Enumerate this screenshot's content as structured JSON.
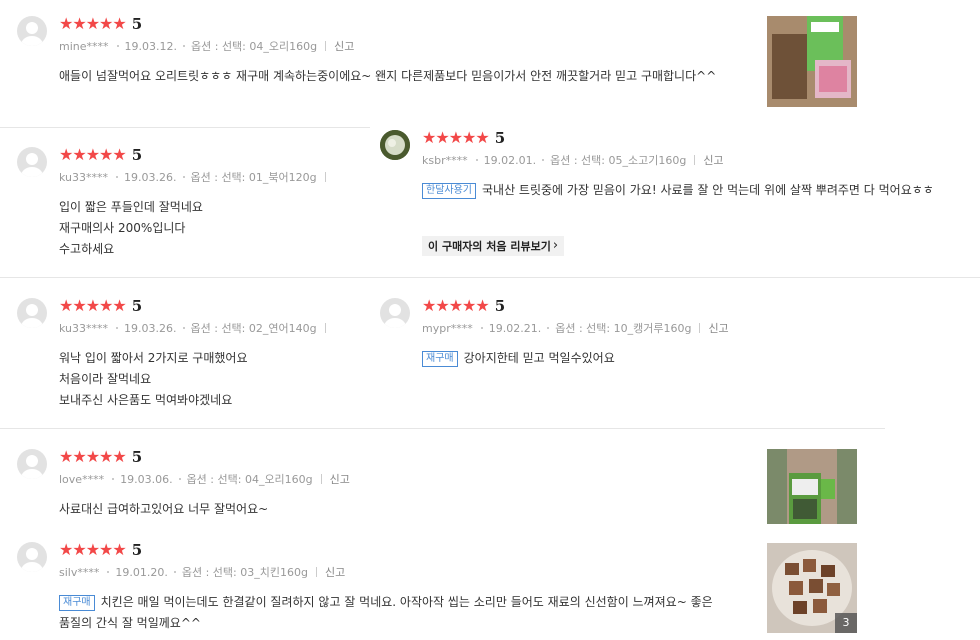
{
  "star_glyph": "★★★★★",
  "colors": {
    "star": "#f24848",
    "badge": "#4a8bd5"
  },
  "reviews": [
    {
      "score": "5",
      "user": "mine****",
      "date": "19.03.12.",
      "option": "옵션 : 선택: 04_오리160g",
      "report": "신고",
      "lines": [
        "애들이 넘잘먹어요 오리트릿ㅎㅎㅎ 재구매 계속하는중이에요~ 왠지 다른제품보다 믿음이가서 안전 깨끗할거라 믿고 구매합니다^^"
      ]
    },
    {
      "score": "5",
      "user": "ku33****",
      "date": "19.03.26.",
      "option": "옵션 : 선택: 01_북어120g",
      "lines": [
        "입이 짧은 푸들인데 잘먹네요",
        "재구매의사 200%입니다",
        "수고하세요"
      ]
    },
    {
      "score": "5",
      "user": "ksbr****",
      "date": "19.02.01.",
      "option": "옵션 : 선택: 05_소고기160g",
      "report": "신고",
      "badge": "한달사용기",
      "lines": [
        "국내산 트릿중에 가장 믿음이 가요! 사료를 잘 안 먹는데 위에 살짝 뿌려주면 다 먹어요ㅎㅎ"
      ],
      "first_review_label": "이 구매자의 처음 리뷰보기"
    },
    {
      "score": "5",
      "user": "ku33****",
      "date": "19.03.26.",
      "option": "옵션 : 선택: 02_연어140g",
      "lines": [
        "워낙 입이 짧아서 2가지로 구매했어요",
        "처음이라 잘먹네요",
        "보내주신 사은품도 먹여봐야겠네요"
      ]
    },
    {
      "score": "5",
      "user": "mypr****",
      "date": "19.02.21.",
      "option": "옵션 : 선택: 10_캥거루160g",
      "report": "신고",
      "badge": "재구매",
      "lines": [
        "강아지한테 믿고 먹일수있어요"
      ]
    },
    {
      "score": "5",
      "user": "love****",
      "date": "19.03.06.",
      "option": "옵션 : 선택: 04_오리160g",
      "report": "신고",
      "lines": [
        "사료대신 급여하고있어요 너무 잘먹어요~"
      ]
    },
    {
      "score": "5",
      "user": "silv****",
      "date": "19.01.20.",
      "option": "옵션 : 선택: 03_치킨160g",
      "report": "신고",
      "badge": "재구매",
      "lines": [
        "치킨은 매일 먹이는데도 한결같이 질려하지 않고 잘 먹네요. 아작아작 씹는 소리만 들어도 재료의 신선함이 느껴져요~ 좋은",
        "품질의 간식 잘 먹일께요^^"
      ],
      "photo_count": "3"
    }
  ]
}
